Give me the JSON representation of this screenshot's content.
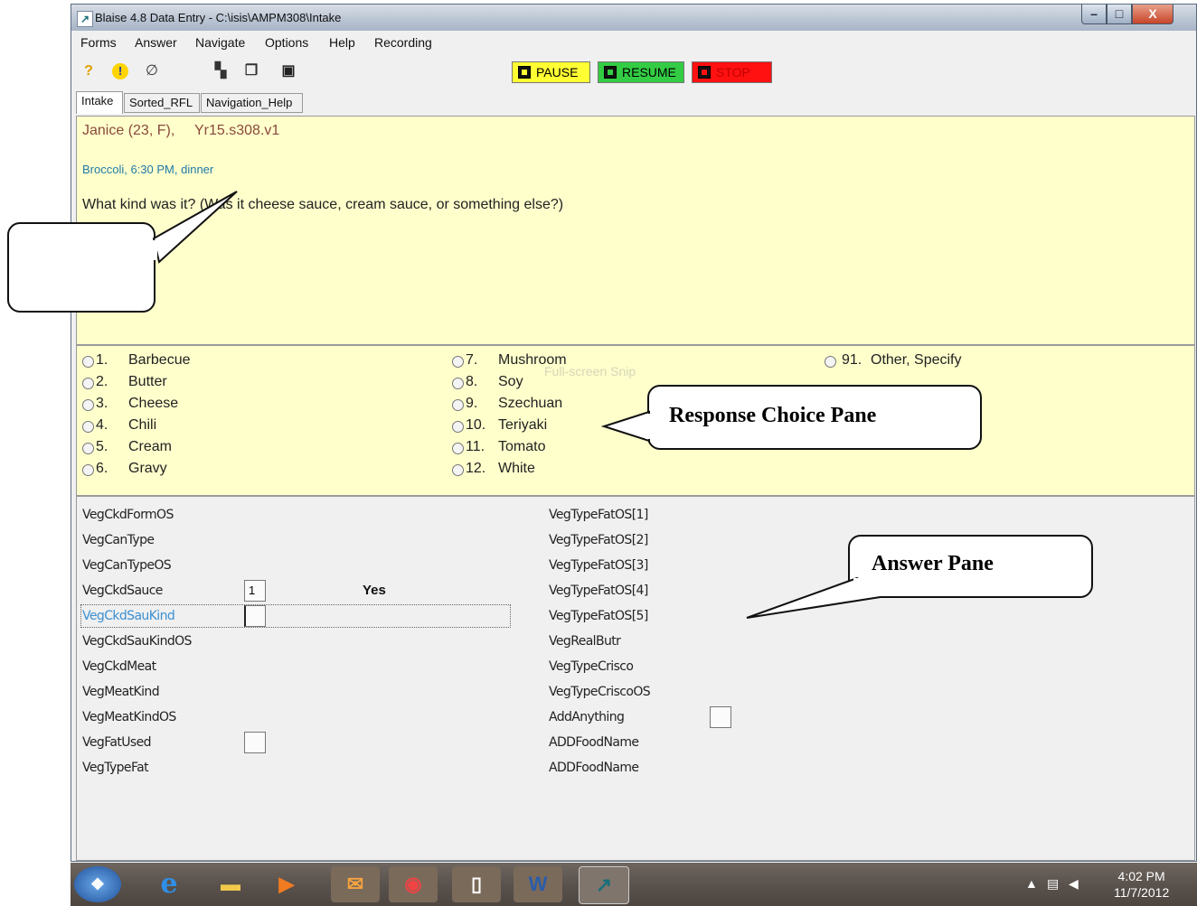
{
  "window": {
    "title": "Blaise 4.8 Data Entry - C:\\isis\\AMPM308\\Intake",
    "icon": "blaise-app-icon",
    "buttons": {
      "minimize": "–",
      "maximize": "□",
      "close": "X"
    }
  },
  "menu": [
    "Forms",
    "Answer",
    "Navigate",
    "Options",
    "Help",
    "Recording"
  ],
  "toolbar": {
    "icons": [
      "help-icon",
      "alert-icon",
      "attach-icon",
      "search-icon",
      "copy-icon",
      "save-icon"
    ],
    "recording": [
      {
        "label": "PAUSE",
        "color": "#ffff00"
      },
      {
        "label": "RESUME",
        "color": "#33cc33"
      },
      {
        "label": "STOP",
        "color": "#ff0000"
      }
    ]
  },
  "tabs": [
    "Intake",
    "Sorted_RFL",
    "Navigation_Help"
  ],
  "question": {
    "respondent": "Janice (23, F),",
    "year": "Yr15.s308.v1",
    "food": "Broccoli, 6:30 PM, dinner",
    "text": "What kind was it? (Was it cheese sauce, cream sauce, or something else?)"
  },
  "choices": {
    "col1": [
      {
        "num": "1.",
        "label": "Barbecue"
      },
      {
        "num": "2.",
        "label": "Butter"
      },
      {
        "num": "3.",
        "label": "Cheese"
      },
      {
        "num": "4.",
        "label": "Chili"
      },
      {
        "num": "5.",
        "label": "Cream"
      },
      {
        "num": "6.",
        "label": "Gravy"
      }
    ],
    "col2": [
      {
        "num": "7.",
        "label": "Mushroom"
      },
      {
        "num": "8.",
        "label": "Soy"
      },
      {
        "num": "9.",
        "label": "Szechuan"
      },
      {
        "num": "10.",
        "label": "Teriyaki"
      },
      {
        "num": "11.",
        "label": "Tomato"
      },
      {
        "num": "12.",
        "label": "White"
      }
    ],
    "col3": [
      {
        "num": "91.",
        "label": "Other, Specify"
      }
    ],
    "ghost_text": "Full-screen Snip"
  },
  "answers": {
    "left": [
      {
        "field": "VegCkdFormOS",
        "box": false,
        "value": ""
      },
      {
        "field": "VegCanType",
        "box": false,
        "value": ""
      },
      {
        "field": "VegCanTypeOS",
        "box": false,
        "value": ""
      },
      {
        "field": "VegCkdSauce",
        "box": true,
        "value": "1"
      },
      {
        "field": "VegCkdSauKind",
        "box": true,
        "value": "",
        "current": true
      },
      {
        "field": "VegCkdSauKindOS",
        "box": false,
        "value": ""
      },
      {
        "field": "VegCkdMeat",
        "box": false,
        "value": ""
      },
      {
        "field": "VegMeatKind",
        "box": false,
        "value": ""
      },
      {
        "field": "VegMeatKindOS",
        "box": false,
        "value": ""
      },
      {
        "field": "VegFatUsed",
        "box": true,
        "value": ""
      },
      {
        "field": "VegTypeFat",
        "box": false,
        "value": ""
      }
    ],
    "right": [
      {
        "field": "VegTypeFatOS[1]",
        "box": false
      },
      {
        "field": "VegTypeFatOS[2]",
        "box": false
      },
      {
        "field": "VegTypeFatOS[3]",
        "box": false
      },
      {
        "field": "VegTypeFatOS[4]",
        "box": false
      },
      {
        "field": "VegTypeFatOS[5]",
        "box": false
      },
      {
        "field": "VegRealButr",
        "box": false
      },
      {
        "field": "VegTypeCrisco",
        "box": false
      },
      {
        "field": "VegTypeCriscoOS",
        "box": false
      },
      {
        "field": "AddAnything",
        "box": true
      },
      {
        "field": "ADDFoodName",
        "box": false
      },
      {
        "field": "ADDFoodName",
        "box": false
      }
    ],
    "sauce_text": "Yes"
  },
  "callouts": {
    "question_pane": "",
    "response_choice_pane": "Response Choice Pane",
    "answer_pane": "Answer Pane"
  },
  "taskbar": {
    "apps": [
      "start-orb-icon",
      "internet-explorer-icon",
      "file-explorer-icon",
      "media-player-icon",
      "outlook-icon",
      "chrome-icon",
      "blank-document-icon",
      "word-icon",
      "blaise-icon"
    ],
    "time": "4:02 PM",
    "date": "11/7/2012"
  }
}
